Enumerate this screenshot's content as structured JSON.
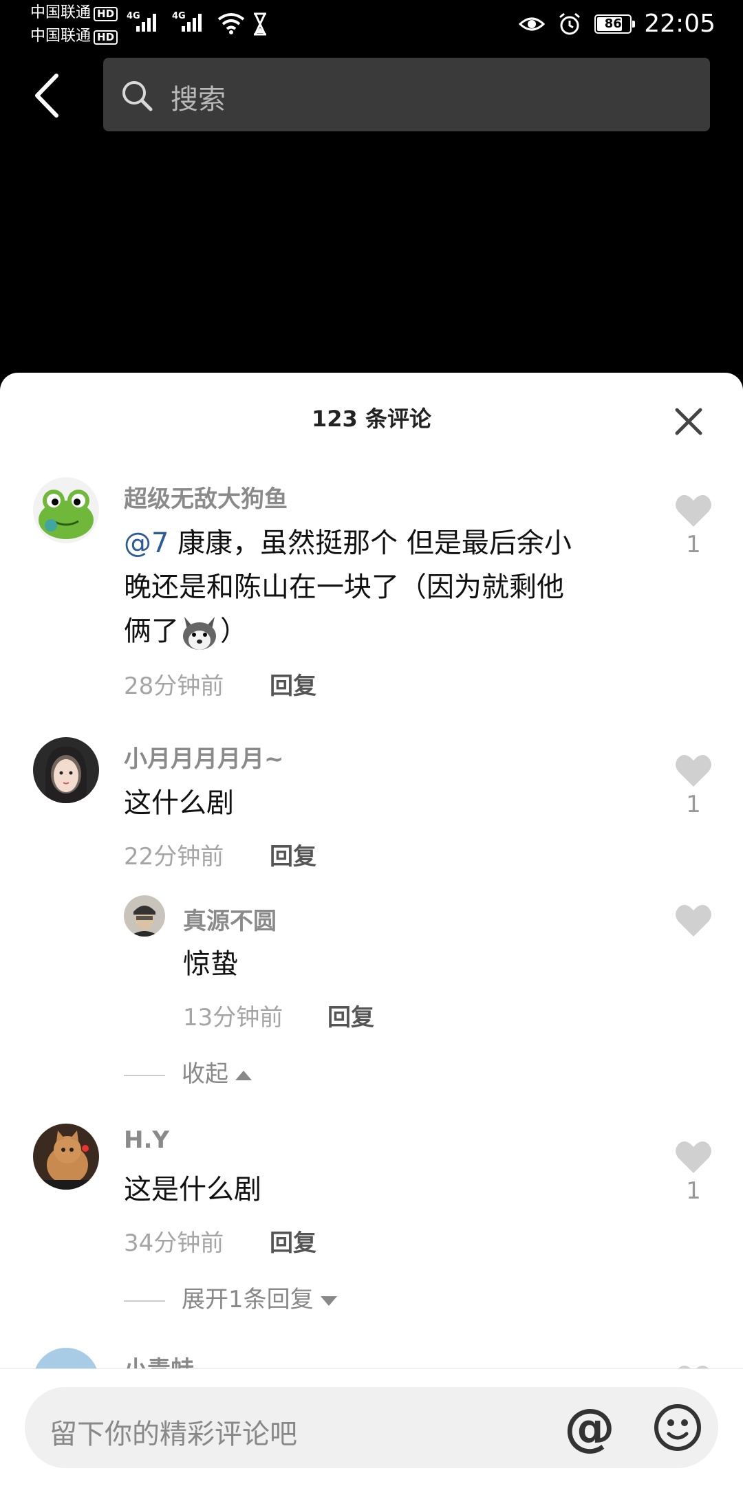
{
  "status_bar": {
    "carrier1": "中国联通",
    "carrier2": "中国联通",
    "hd": "HD",
    "net1": "4G",
    "net2": "4G",
    "battery": "86",
    "time": "22:05"
  },
  "header": {
    "search_placeholder": "搜索"
  },
  "sheet": {
    "title": "123 条评论"
  },
  "comments": [
    {
      "username": "超级无敌大狗鱼",
      "mention": "@7",
      "lines": [
        "康康，虽然挺那个 但是最后余小",
        "晚还是和陈山在一块了（因为就剩他",
        "俩了",
        "）"
      ],
      "time": "28分钟前",
      "reply": "回复",
      "likes": "1"
    },
    {
      "username": "小月月月月月~",
      "text": "这什么剧",
      "time": "22分钟前",
      "reply": "回复",
      "likes": "1",
      "replies": [
        {
          "username": "真源不圆",
          "text": "惊蛰",
          "time": "13分钟前",
          "reply": "回复"
        }
      ],
      "collapse": "收起"
    },
    {
      "username": "H.Y",
      "text": "这是什么剧",
      "time": "34分钟前",
      "reply": "回复",
      "likes": "1",
      "expand": "展开1条回复"
    },
    {
      "username": "小青蛙"
    }
  ],
  "bottom": {
    "placeholder": "留下你的精彩评论吧",
    "at": "@"
  },
  "colors": {
    "mention": "#2d5b9a",
    "username": "#8a8a8a",
    "meta": "#a5a5a5",
    "like": "#d0d0d0"
  }
}
